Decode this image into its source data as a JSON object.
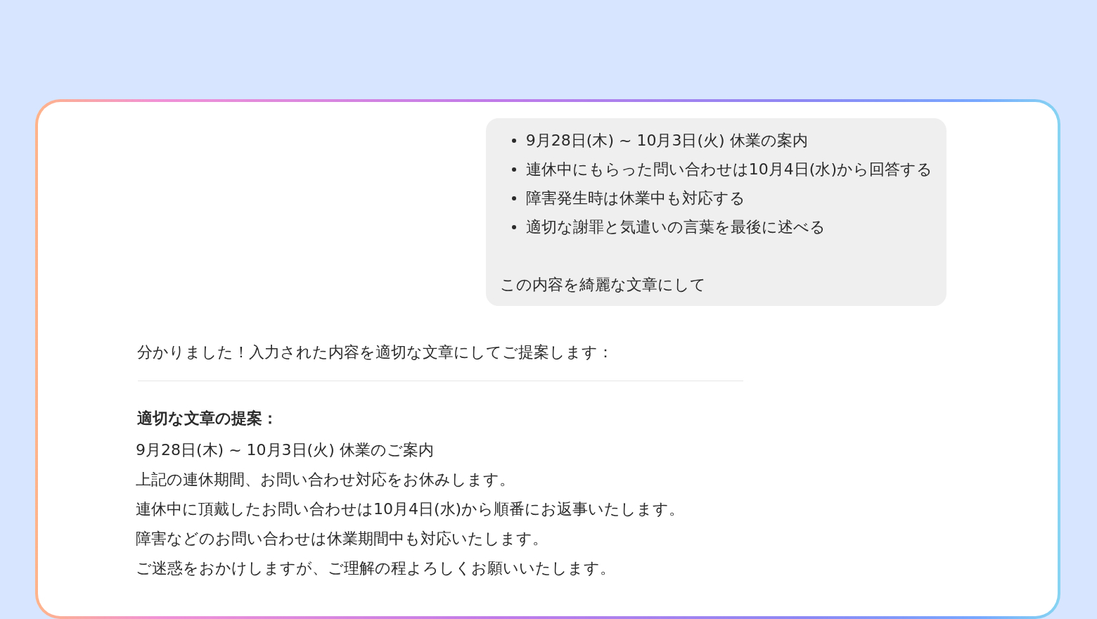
{
  "user_message": {
    "bullets": [
      "9月28日(木) ~ 10月3日(火) 休業の案内",
      "連休中にもらった問い合わせは10月4日(水)から回答する",
      "障害発生時は休業中も対応する",
      "適切な謝罪と気遣いの言葉を最後に述べる"
    ],
    "request": "この内容を綺麗な文章にして"
  },
  "assistant_message": {
    "intro": "分かりました！入力された内容を適切な文章にしてご提案します：",
    "heading": "適切な文章の提案：",
    "lines": [
      "9月28日(木) ~ 10月3日(火) 休業のご案内",
      "上記の連休期間、お問い合わせ対応をお休みします。",
      "連休中に頂戴したお問い合わせは10月4日(水)から順番にお返事いたします。",
      "障害などのお問い合わせは休業期間中も対応いたします。",
      "ご迷惑をおかけしますが、ご理解の程よろしくお願いいたします。"
    ]
  }
}
